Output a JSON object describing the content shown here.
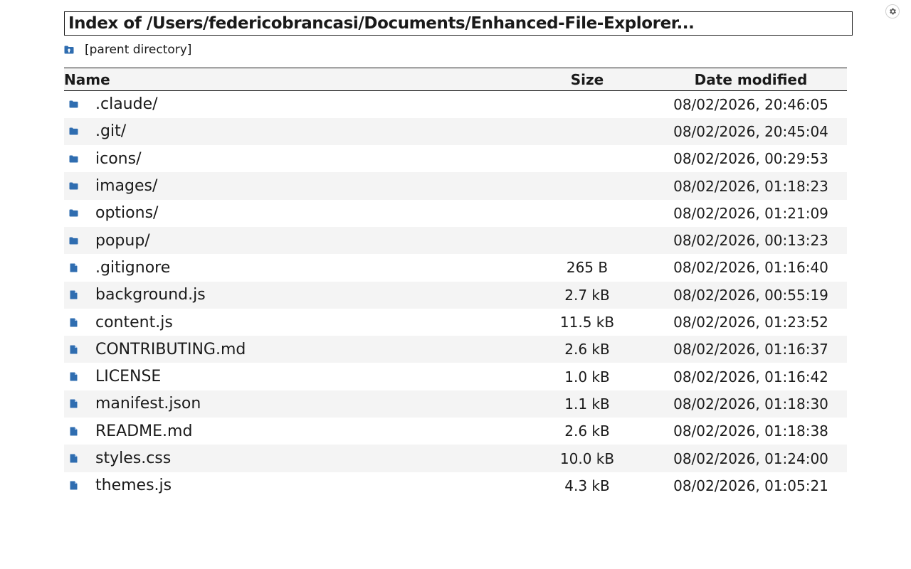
{
  "page": {
    "title": "Index of /Users/federicobrancasi/Documents/Enhanced-File-Explorer...",
    "settings_icon": "gear-icon",
    "parent_link": "[parent directory]",
    "accent_color": "#2f6db0"
  },
  "table": {
    "headers": {
      "name": "Name",
      "size": "Size",
      "date": "Date modified"
    },
    "rows": [
      {
        "name": ".claude/",
        "type": "folder",
        "size": "",
        "date": "08/02/2026, 20:46:05"
      },
      {
        "name": ".git/",
        "type": "folder",
        "size": "",
        "date": "08/02/2026, 20:45:04"
      },
      {
        "name": "icons/",
        "type": "folder",
        "size": "",
        "date": "08/02/2026, 00:29:53"
      },
      {
        "name": "images/",
        "type": "folder",
        "size": "",
        "date": "08/02/2026, 01:18:23"
      },
      {
        "name": "options/",
        "type": "folder",
        "size": "",
        "date": "08/02/2026, 01:21:09"
      },
      {
        "name": "popup/",
        "type": "folder",
        "size": "",
        "date": "08/02/2026, 00:13:23"
      },
      {
        "name": ".gitignore",
        "type": "file",
        "size": "265 B",
        "date": "08/02/2026, 01:16:40"
      },
      {
        "name": "background.js",
        "type": "file",
        "size": "2.7 kB",
        "date": "08/02/2026, 00:55:19"
      },
      {
        "name": "content.js",
        "type": "file",
        "size": "11.5 kB",
        "date": "08/02/2026, 01:23:52"
      },
      {
        "name": "CONTRIBUTING.md",
        "type": "file",
        "size": "2.6 kB",
        "date": "08/02/2026, 01:16:37"
      },
      {
        "name": "LICENSE",
        "type": "file",
        "size": "1.0 kB",
        "date": "08/02/2026, 01:16:42"
      },
      {
        "name": "manifest.json",
        "type": "file",
        "size": "1.1 kB",
        "date": "08/02/2026, 01:18:30"
      },
      {
        "name": "README.md",
        "type": "file",
        "size": "2.6 kB",
        "date": "08/02/2026, 01:18:38"
      },
      {
        "name": "styles.css",
        "type": "file",
        "size": "10.0 kB",
        "date": "08/02/2026, 01:24:00"
      },
      {
        "name": "themes.js",
        "type": "file",
        "size": "4.3 kB",
        "date": "08/02/2026, 01:05:21"
      }
    ]
  }
}
